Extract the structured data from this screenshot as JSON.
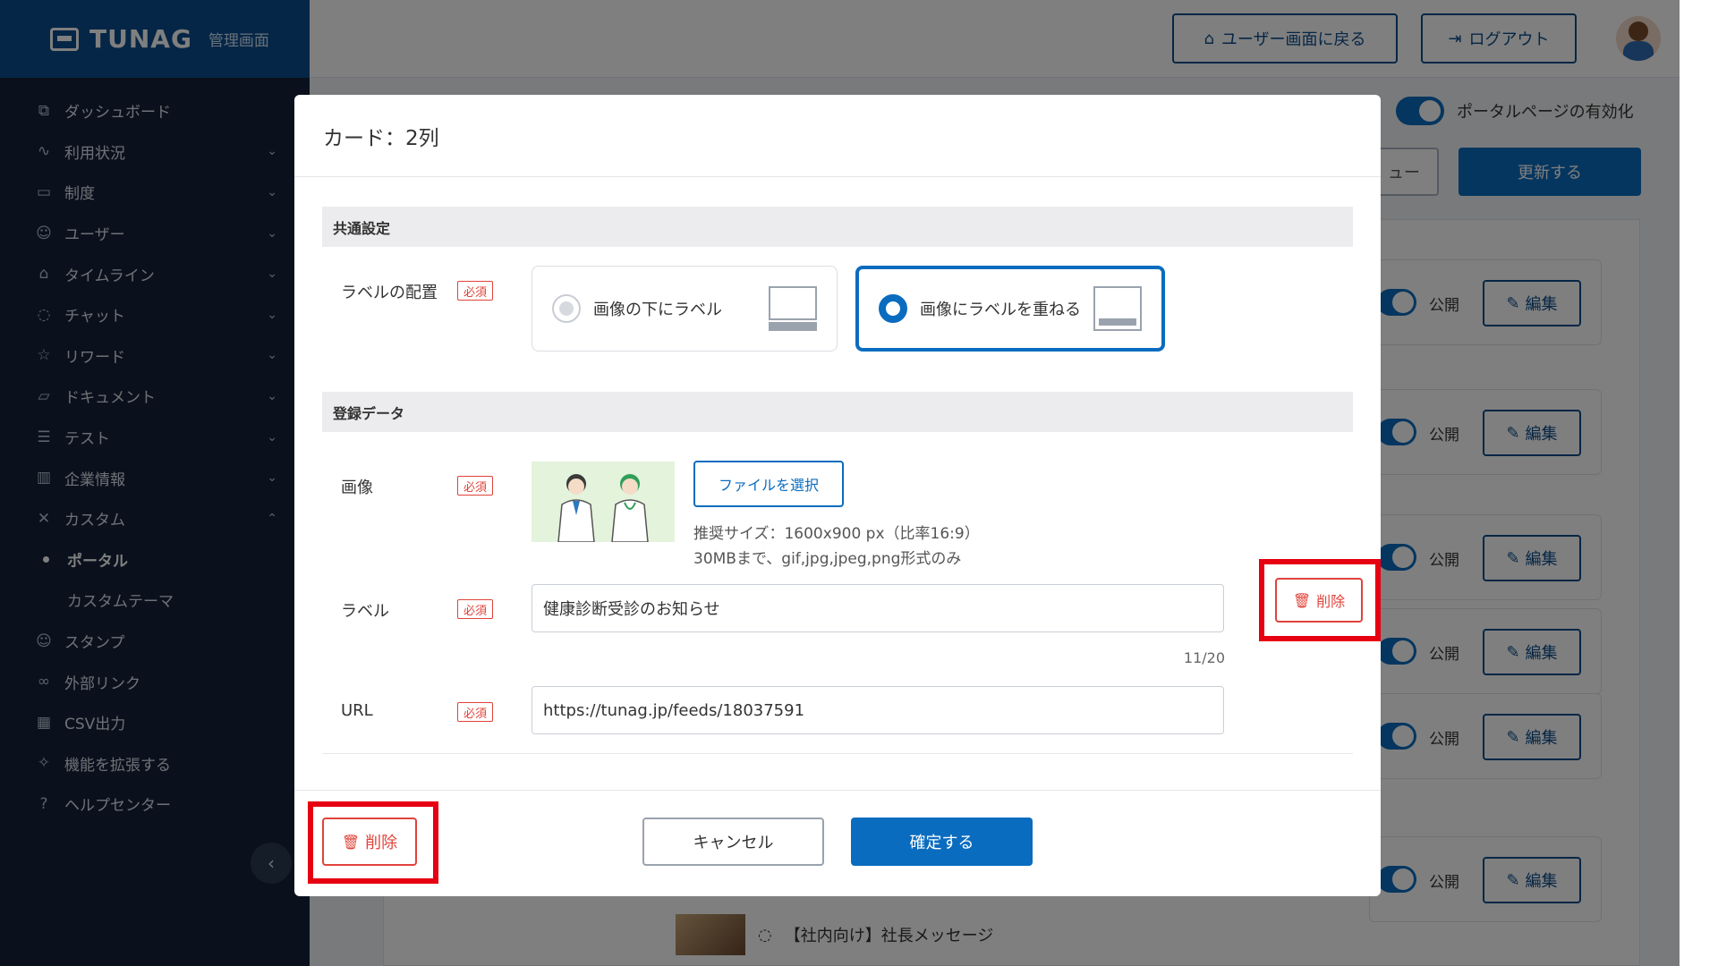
{
  "brand": {
    "name": "TUNAG",
    "subtitle": "管理画面"
  },
  "topbar": {
    "back_label": "ユーザー画面に戻る",
    "logout_label": "ログアウト"
  },
  "sidebar": {
    "items": [
      {
        "label": "ダッシュボード",
        "icon": "chart-icon",
        "chevron": ""
      },
      {
        "label": "利用状況",
        "icon": "pulse-icon",
        "chevron": "⌄"
      },
      {
        "label": "制度",
        "icon": "book-icon",
        "chevron": "⌄"
      },
      {
        "label": "ユーザー",
        "icon": "users-icon",
        "chevron": "⌄"
      },
      {
        "label": "タイムライン",
        "icon": "home-icon",
        "chevron": "⌄"
      },
      {
        "label": "チャット",
        "icon": "chat-icon",
        "chevron": "⌄"
      },
      {
        "label": "リワード",
        "icon": "star-icon",
        "chevron": "⌄"
      },
      {
        "label": "ドキュメント",
        "icon": "folder-icon",
        "chevron": "⌄"
      },
      {
        "label": "テスト",
        "icon": "test-icon",
        "chevron": "⌄"
      },
      {
        "label": "企業情報",
        "icon": "building-icon",
        "chevron": "⌄"
      },
      {
        "label": "カスタム",
        "icon": "tools-icon",
        "chevron": "⌃"
      }
    ],
    "sub_items": [
      {
        "label": "ポータル"
      },
      {
        "label": "カスタムテーマ"
      }
    ],
    "bottom_items": [
      {
        "label": "スタンプ",
        "icon": "smile-icon"
      },
      {
        "label": "外部リンク",
        "icon": "link-icon"
      },
      {
        "label": "CSV出力",
        "icon": "table-icon"
      },
      {
        "label": "機能を拡張する",
        "icon": "sparkle-icon"
      },
      {
        "label": "ヘルプセンター",
        "icon": "help-icon"
      }
    ],
    "collapse_glyph": "‹"
  },
  "background": {
    "portal_toggle_label": "ポータルページの有効化",
    "preview_label": "ュー",
    "update_label": "更新する",
    "public_label": "公開",
    "edit_label": "編集",
    "list_item_label": "【社内向け】社長メッセージ"
  },
  "modal": {
    "title": "カード：2列",
    "common_section": "共通設定",
    "label_position": {
      "label": "ラベルの配置",
      "required": "必須",
      "option_below": "画像の下にラベル",
      "option_overlay": "画像にラベルを重ねる",
      "selected": "option_overlay"
    },
    "data_section": "登録データ",
    "image": {
      "label": "画像",
      "required": "必須",
      "file_button": "ファイルを選択",
      "hint_size": "推奨サイズ：1600x900 px（比率16:9）",
      "hint_format": "30MBまで、gif,jpg,jpeg,png形式のみ"
    },
    "text_label": {
      "label": "ラベル",
      "required": "必須",
      "value": "健康診断受診のお知らせ",
      "counter": "11/20"
    },
    "url": {
      "label": "URL",
      "required": "必須",
      "value": "https://tunag.jp/feeds/18037591"
    },
    "item_delete_label": "削除",
    "delete_label": "削除",
    "cancel_label": "キャンセル",
    "confirm_label": "確定する"
  },
  "colors": {
    "primary": "#0a6cbf",
    "danger": "#e0433a",
    "highlight": "#e60012",
    "sidebar": "#14233a"
  }
}
